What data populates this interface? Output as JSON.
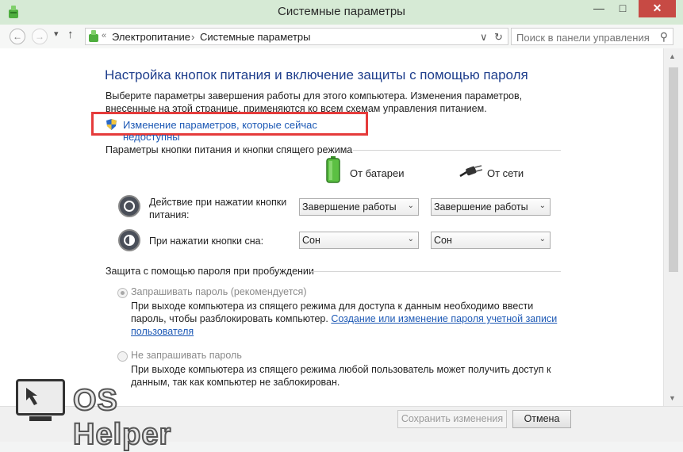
{
  "window": {
    "title": "Системные параметры",
    "min_glyph": "—",
    "max_glyph": "□",
    "close_glyph": "✕"
  },
  "navbar": {
    "back_glyph": "←",
    "forward_glyph": "→",
    "recent_glyph": "▾",
    "up_glyph": "↑",
    "breadcrumb_sep": "«",
    "crumbs": [
      "Электропитание",
      "Системные параметры"
    ],
    "crumb_arrow": "›",
    "dropdown_glyph": "∨",
    "refresh_glyph": "↻",
    "search_placeholder": "Поиск в панели управления",
    "search_glyph": "⚲"
  },
  "page": {
    "title": "Настройка кнопок питания и включение защиты с помощью пароля",
    "description": "Выберите параметры завершения работы для этого компьютера. Изменения параметров, внесенные на этой странице, применяются ко всем схемам управления питанием.",
    "uac_link": "Изменение параметров, которые сейчас недоступны"
  },
  "power_buttons": {
    "section_title": "Параметры кнопки питания и кнопки спящего режима",
    "battery_label": "От батареи",
    "ac_label": "От сети",
    "rows": [
      {
        "label": "Действие при нажатии кнопки питания:",
        "battery": "Завершение работы",
        "ac": "Завершение работы"
      },
      {
        "label": "При нажатии кнопки сна:",
        "battery": "Сон",
        "ac": "Сон"
      }
    ],
    "select_arrow": "⌄"
  },
  "password": {
    "section_title": "Защита с помощью пароля при пробуждении",
    "options": [
      {
        "label": "Запрашивать пароль (рекомендуется)",
        "desc": "При выходе компьютера из спящего режима для доступа к данным необходимо ввести пароль, чтобы разблокировать компьютер.",
        "link": "Создание или изменение пароля учетной записи пользователя",
        "selected": true
      },
      {
        "label": "Не запрашивать пароль",
        "desc": "При выходе компьютера из спящего режима любой пользователь может получить доступ к данным, так как компьютер не заблокирован.",
        "selected": false
      }
    ]
  },
  "footer": {
    "save_label": "Сохранить изменения",
    "cancel_label": "Отмена"
  },
  "watermark": {
    "text": "OS Helper"
  },
  "colors": {
    "title_blue": "#1e3e8c",
    "link_blue": "#1d59b5",
    "highlight_red": "#e53b3b",
    "close_red": "#c74a44"
  }
}
